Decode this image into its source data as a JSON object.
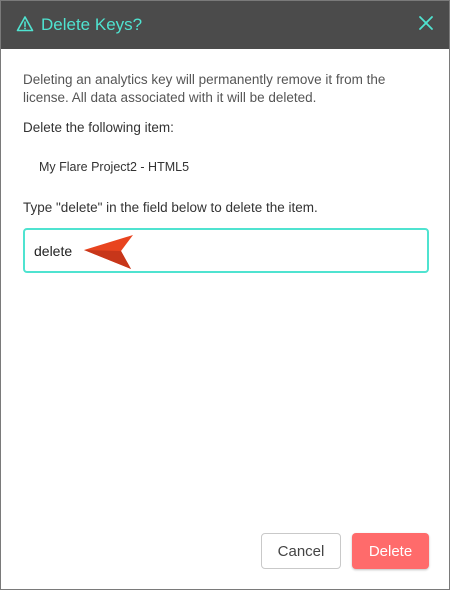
{
  "dialog": {
    "title": "Delete Keys?",
    "title_icon": "warning-icon",
    "close_icon": "close-icon",
    "description": "Deleting an analytics key will permanently remove it from the license. All data associated with it will be deleted.",
    "items_label": "Delete the following item:",
    "item_name": "My Flare Project2 - HTML5",
    "instruction": "Type \"delete\" in the field below to delete the item.",
    "confirm_input": {
      "value": "delete",
      "placeholder": ""
    },
    "cancel_label": "Cancel",
    "delete_label": "Delete"
  },
  "colors": {
    "header_bg": "#4b4b4b",
    "accent": "#4fe3d0",
    "danger": "#ff6b6b",
    "annotation_arrow": "#e8441f"
  }
}
